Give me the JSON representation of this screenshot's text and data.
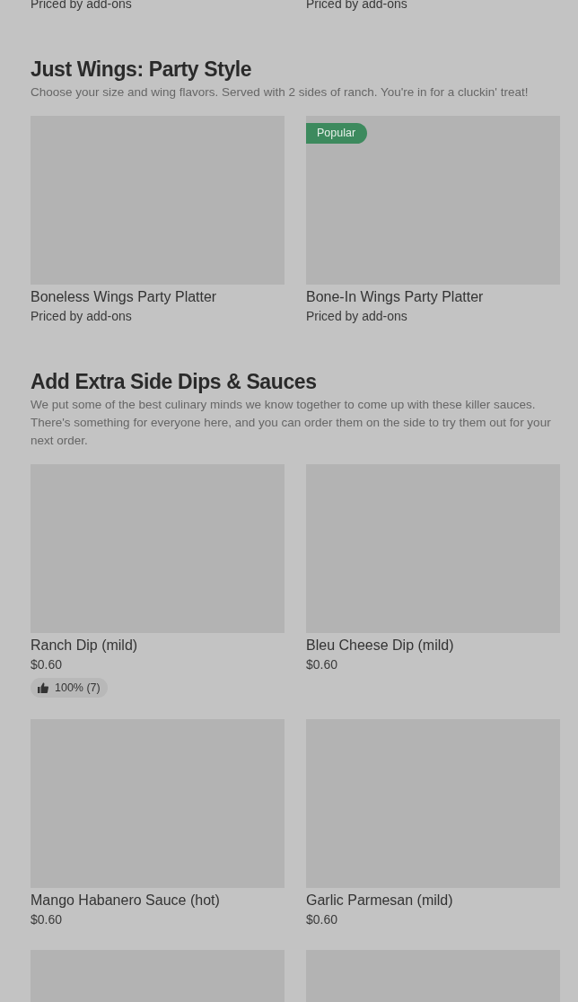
{
  "previous_items": [
    {
      "price": "Priced by add-ons"
    },
    {
      "price": "Priced by add-ons"
    }
  ],
  "sections": [
    {
      "title": "Just Wings: Party Style",
      "description": "Choose your size and wing flavors. Served with 2 sides of ranch. You're in for a cluckin' treat!",
      "items": [
        {
          "kind": "card",
          "name": "Boneless Wings Party Platter",
          "price": "Priced by add-ons"
        },
        {
          "kind": "card",
          "name": "Bone-In Wings Party Platter",
          "price": "Priced by add-ons",
          "badge": "Popular"
        }
      ]
    },
    {
      "title": "Add Extra Side Dips & Sauces",
      "description": "We put some of the best culinary minds we know together to come up with these killer sauces. There's something for everyone here, and you can order them on the side to try them out for your next order.",
      "items": [
        {
          "kind": "card",
          "name": "Ranch Dip (mild)",
          "price": "$0.60",
          "rating": "100% (7)"
        },
        {
          "kind": "card",
          "name": "Bleu Cheese Dip (mild)",
          "price": "$0.60"
        },
        {
          "kind": "card",
          "name": "Mango Habanero Sauce (hot)",
          "price": "$0.60"
        },
        {
          "kind": "card",
          "name": "Garlic Parmesan (mild)",
          "price": "$0.60"
        },
        {
          "kind": "picture"
        },
        {
          "kind": "picture"
        }
      ]
    }
  ]
}
